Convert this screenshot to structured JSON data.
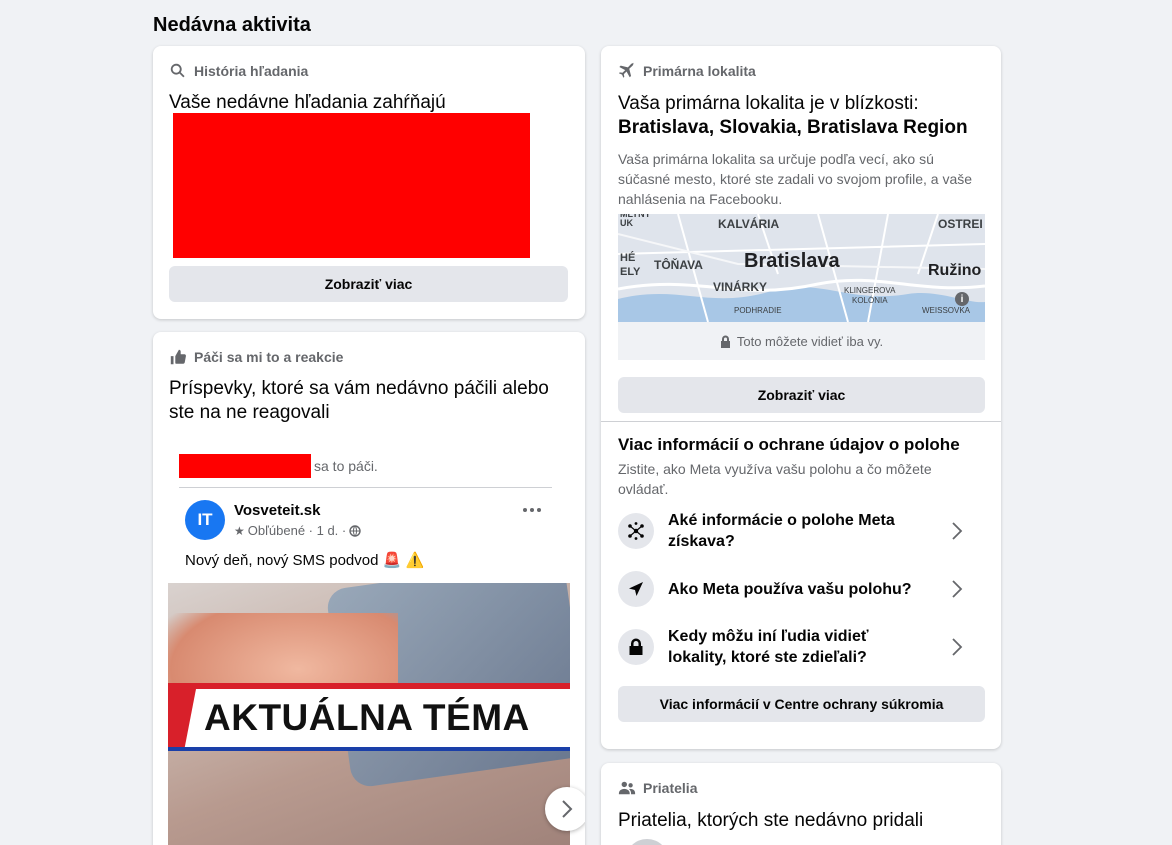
{
  "page": {
    "section_title": "Nedávna aktivita"
  },
  "search_card": {
    "header": "História hľadania",
    "text": "Vaše nedávne hľadania zahŕňajú",
    "button": "Zobraziť viac"
  },
  "likes_card": {
    "header": "Páči sa mi to a reakcie",
    "text": "Príspevky, ktoré sa vám nedávno páčili alebo ste na ne reagovali",
    "liked_suffix": "sa to páči.",
    "post": {
      "avatar_initials": "IT",
      "author": "Vosveteit.sk",
      "meta": "Obľúbené · 1 d. ·",
      "text": "Nový deň, nový SMS podvod 🚨 ⚠️",
      "image_banner": "AKTUÁLNA TÉMA"
    }
  },
  "location_card": {
    "header": "Primárna lokalita",
    "intro": "Vaša primárna lokalita je v blízkosti:",
    "place": "Bratislava, Slovakia, Bratislava Region",
    "description": "Vaša primárna lokalita sa určuje podľa vecí, ako sú súčasné mesto, ktoré ste zadali vo svojom profile, a vaše nahlásenia na Facebooku.",
    "map_labels": {
      "mlyny": "MLYNY UK",
      "kalvaria": "KALVÁRIA",
      "ostre": "OSTREI",
      "he": "HÉ",
      "ely": "ELY",
      "tonava": "TÔŇAVA",
      "bratislava": "Bratislava",
      "ruzino": "Ružino",
      "vinarky": "VINÁRKY",
      "klingerova": "KLINGEROVA",
      "kolonia": "KOLÓNIA",
      "podhradie": "PODHRADIE",
      "weissova": "WEISSOVKA"
    },
    "privacy_note": "Toto môžete vidieť iba vy.",
    "button": "Zobraziť viac",
    "more_title": "Viac informácií o ochrane údajov o polohe",
    "more_desc": "Zistite, ako Meta využíva vašu polohu a čo môžete ovládať.",
    "items": [
      {
        "label": "Aké informácie o polohe Meta získava?",
        "icon": "network-icon"
      },
      {
        "label": "Ako Meta používa vašu polohu?",
        "icon": "navigation-arrow-icon"
      },
      {
        "label": "Kedy môžu iní ľudia vidieť lokality, ktoré ste zdieľali?",
        "icon": "lock-icon"
      }
    ],
    "privacy_center_button": "Viac informácií v Centre ochrany súkromia"
  },
  "friends_card": {
    "header": "Priatelia",
    "text": "Priatelia, ktorých ste nedávno pridali"
  },
  "colors": {
    "background": "#f0f2f5",
    "button": "#e4e6eb",
    "muted": "#65676b",
    "redaction": "#ff0000",
    "avatar": "#1877f2"
  }
}
